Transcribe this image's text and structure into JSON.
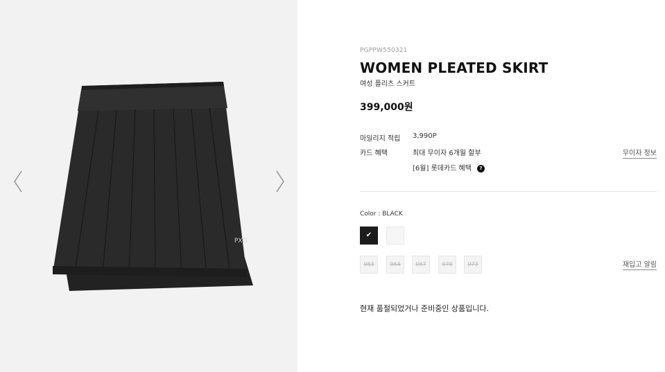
{
  "product": {
    "code": "PGPPW550321",
    "title": "WOMEN PLEATED SKIRT",
    "subtitle": "여성 플리츠 스커트",
    "price": "399,000원"
  },
  "benefits": {
    "mileage_label": "마일리지 적립",
    "mileage_value": "3,990P",
    "card_label": "카드 혜택",
    "card_value_1": "최대 무이자 6개월 할부",
    "card_value_2": "[6월] 롯데카드 혜택",
    "installment_link": "무이자 정보",
    "help_icon_glyph": "?"
  },
  "options": {
    "color_label": "Color : BLACK",
    "colors": [
      {
        "name": "BLACK",
        "hex": "#1c1c1c",
        "selected": true
      },
      {
        "name": "WHITE",
        "hex": "#f6f6f6",
        "selected": false
      }
    ],
    "check_glyph": "✔",
    "sizes": [
      "063",
      "064",
      "067",
      "070",
      "073"
    ],
    "restock_link": "재입고 알림"
  },
  "status": {
    "soldout_text": "현재 품절되었거나 준비중인 상품입니다."
  },
  "gallery": {
    "prev_icon": "chevron-left-icon",
    "next_icon": "chevron-right-icon",
    "logo_text": "PXG"
  }
}
